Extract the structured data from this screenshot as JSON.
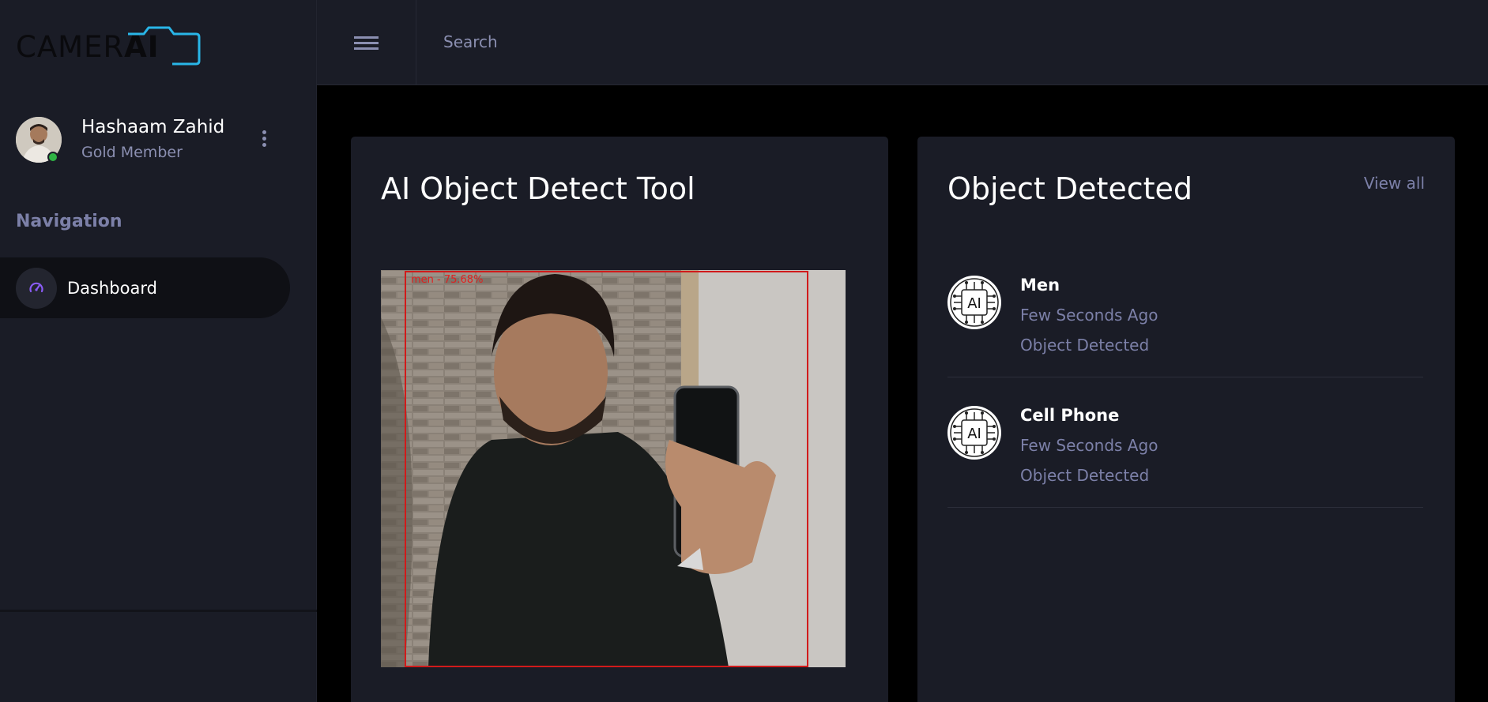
{
  "app": {
    "logo_text_main": "CAMER",
    "logo_text_accent": "AI",
    "accent_color": "#29b6e8"
  },
  "user": {
    "name": "Hashaam Zahid",
    "role": "Gold Member",
    "status": "online"
  },
  "sidebar": {
    "heading": "Navigation",
    "items": [
      {
        "label": "Dashboard",
        "icon": "speedometer-icon",
        "active": true
      }
    ]
  },
  "topbar": {
    "search_placeholder": "Search"
  },
  "detect_tool": {
    "title": "AI Object Detect Tool",
    "bbox_label": "men - 75.68%",
    "bbox_color": "#d11a1a"
  },
  "detections_panel": {
    "title": "Object Detected",
    "view_all": "View all",
    "items": [
      {
        "name": "Men",
        "time": "Few Seconds Ago",
        "status": "Object Detected",
        "icon": "ai-chip-icon"
      },
      {
        "name": "Cell Phone",
        "time": "Few Seconds Ago",
        "status": "Object Detected",
        "icon": "ai-chip-icon"
      }
    ]
  }
}
